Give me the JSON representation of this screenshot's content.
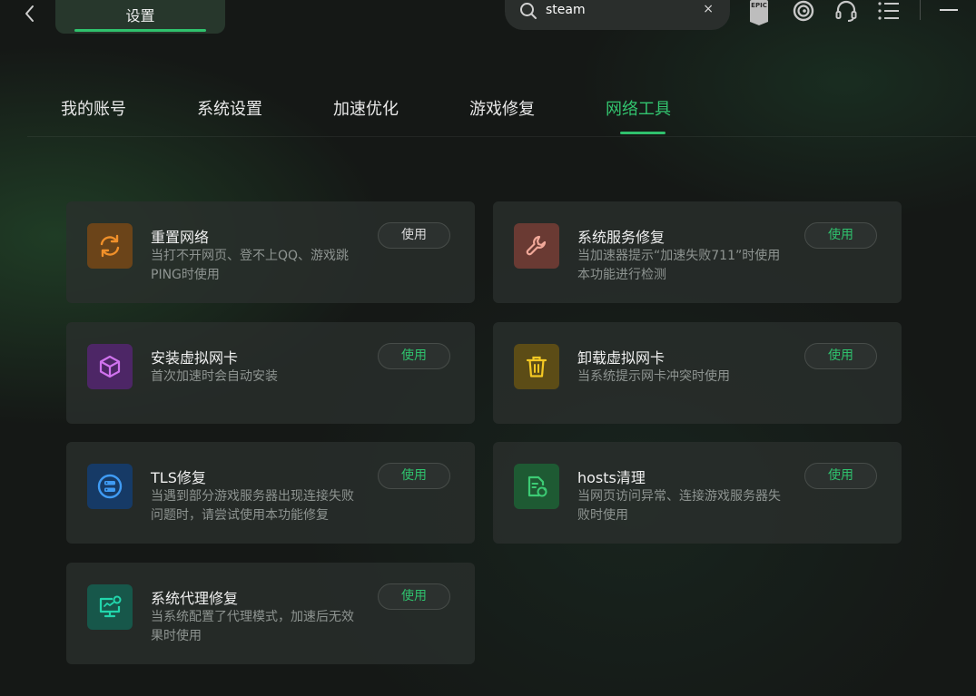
{
  "header": {
    "settings_tab": "设置",
    "search": {
      "value": "steam",
      "clear": "×"
    },
    "epic_label": "EPIC"
  },
  "tabs": [
    {
      "label": "我的账号",
      "active": false
    },
    {
      "label": "系统设置",
      "active": false
    },
    {
      "label": "加速优化",
      "active": false
    },
    {
      "label": "游戏修复",
      "active": false
    },
    {
      "label": "网络工具",
      "active": true
    }
  ],
  "tools": [
    {
      "title": "重置网络",
      "desc": "当打不开网页、登不上QQ、游戏跳PING时使用",
      "button": "使用",
      "icon": "refresh-icon",
      "color": "#e08a2a"
    },
    {
      "title": "系统服务修复",
      "desc": "当加速器提示“加速失败711”时使用本功能进行检测",
      "button": "使用",
      "icon": "wrench-icon",
      "color": "#e89a88"
    },
    {
      "title": "安装虚拟网卡",
      "desc": "首次加速时会自动安装",
      "button": "使用",
      "icon": "cube-icon",
      "color": "#c866e8"
    },
    {
      "title": "卸载虚拟网卡",
      "desc": "当系统提示网卡冲突时使用",
      "button": "使用",
      "icon": "trash-icon",
      "color": "#f2c521"
    },
    {
      "title": "TLS修复",
      "desc": "当遇到部分游戏服务器出现连接失败问题时，请尝试使用本功能修复",
      "button": "使用",
      "icon": "server-icon",
      "color": "#3d97f2"
    },
    {
      "title": "hosts清理",
      "desc": "当网页访问异常、连接游戏服务器失败时使用",
      "button": "使用",
      "icon": "file-refresh-icon",
      "color": "#36c46c"
    },
    {
      "title": "系统代理修复",
      "desc": "当系统配置了代理模式，加速后无效果时使用",
      "button": "使用",
      "icon": "monitor-icon",
      "color": "#1fd1a8"
    }
  ]
}
